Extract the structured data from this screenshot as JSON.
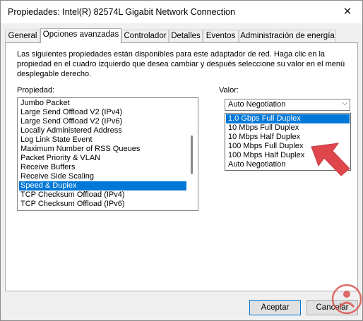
{
  "window": {
    "title": "Propiedades: Intel(R) 82574L Gigabit Network Connection",
    "close_glyph": "✕"
  },
  "tabs": [
    {
      "label": "General"
    },
    {
      "label": "Opciones avanzadas"
    },
    {
      "label": "Controlador"
    },
    {
      "label": "Detalles"
    },
    {
      "label": "Eventos"
    },
    {
      "label": "Administración de energía"
    }
  ],
  "description": "Las siguientes propiedades están disponibles para este adaptador de red. Haga clic en la propiedad en el cuadro izquierdo que desea cambiar y después seleccione su valor en el menú desplegable derecho.",
  "property": {
    "label": "Propiedad:",
    "items": [
      "Jumbo Packet",
      "Large Send Offload V2 (IPv4)",
      "Large Send Offload V2 (IPv6)",
      "Locally Administered Address",
      "Log Link State Event",
      "Maximum Number of RSS Queues",
      "Packet Priority & VLAN",
      "Receive Buffers",
      "Receive Side Scaling",
      "Speed & Duplex",
      "TCP Checksum Offload (IPv4)",
      "TCP Checksum Offload (IPv6)"
    ],
    "selected": "Speed & Duplex"
  },
  "value": {
    "label": "Valor:",
    "current": "Auto Negotiation",
    "options": [
      "1.0 Gbps Full Duplex",
      "10 Mbps Full Duplex",
      "10 Mbps Half Duplex",
      "100 Mbps Full Duplex",
      "100 Mbps Half Duplex",
      "Auto Negotiation"
    ],
    "highlighted": "1.0 Gbps Full Duplex"
  },
  "buttons": {
    "accept": "Aceptar",
    "cancel": "Cancelar"
  },
  "colors": {
    "selection": "#0078d7",
    "arrow": "#e0474c",
    "watermark": "#d9534f"
  },
  "icons": {
    "combo_arrow": "⌵"
  }
}
